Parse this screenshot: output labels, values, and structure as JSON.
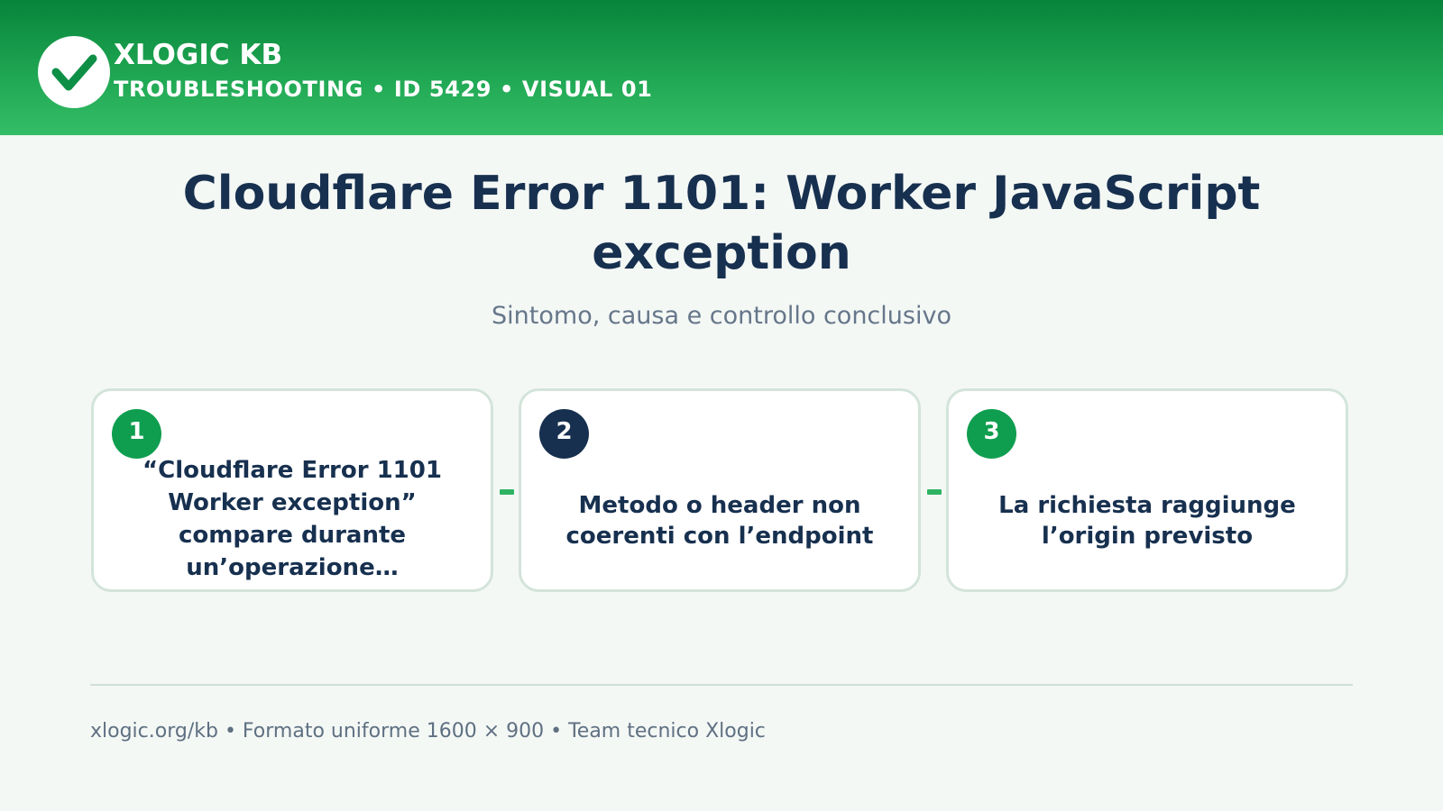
{
  "header": {
    "brand": "XLOGIC KB",
    "breadcrumb": "TROUBLESHOOTING • ID 5429 • VISUAL 01",
    "logo_icon": "check-icon"
  },
  "title": "Cloudflare Error 1101: Worker JavaScript exception",
  "subtitle": "Sintomo, causa e controllo conclusivo",
  "steps": [
    {
      "number": "1",
      "text": "“Cloudflare Error 1101 Worker exception” compare durante un’operazione…",
      "badge_color": "#0f9e4f"
    },
    {
      "number": "2",
      "text": "Metodo o header non coerenti con l’endpoint",
      "badge_color": "#17304f"
    },
    {
      "number": "3",
      "text": "La richiesta raggiunge l’origin previsto",
      "badge_color": "#0f9e4f"
    }
  ],
  "footer": "xlogic.org/kb • Formato uniforme 1600 × 900 • Team tecnico Xlogic",
  "colors": {
    "brand_green": "#1fa652",
    "navy": "#17304f",
    "background": "#f4f8f5",
    "card_border": "#d3e4da",
    "connector": "#2eb363"
  }
}
